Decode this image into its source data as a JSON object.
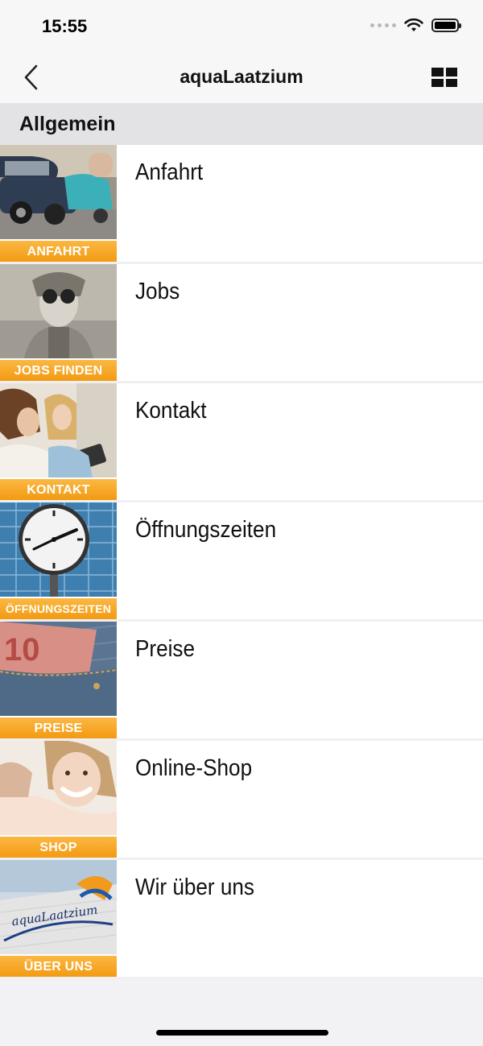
{
  "status_bar": {
    "time": "15:55"
  },
  "nav": {
    "title": "aquaLaatzium"
  },
  "section": {
    "title": "Allgemein"
  },
  "items": [
    {
      "label": "Anfahrt",
      "band": "ANFAHRT",
      "image": "car-scooter-photo"
    },
    {
      "label": "Jobs",
      "band": "JOBS FINDEN",
      "image": "woman-binoculars-photo"
    },
    {
      "label": "Kontakt",
      "band": "KONTAKT",
      "image": "women-tablet-photo"
    },
    {
      "label": "Öffnungszeiten",
      "band": "ÖFFNUNGSZEITEN",
      "image": "station-clock-photo"
    },
    {
      "label": "Preise",
      "band": "PREISE",
      "image": "euro-banknote-jeans-photo"
    },
    {
      "label": "Online-Shop",
      "band": "SHOP",
      "image": "smiling-girl-hug-photo"
    },
    {
      "label": "Wir über uns",
      "band": "ÜBER UNS",
      "image": "aqualaatzium-building-photo"
    }
  ],
  "logo_text": "aquaLaatzium",
  "colors": {
    "band_orange": "#f5a623",
    "nav_bg": "#f7f7f7",
    "section_bg": "#e3e3e6"
  }
}
